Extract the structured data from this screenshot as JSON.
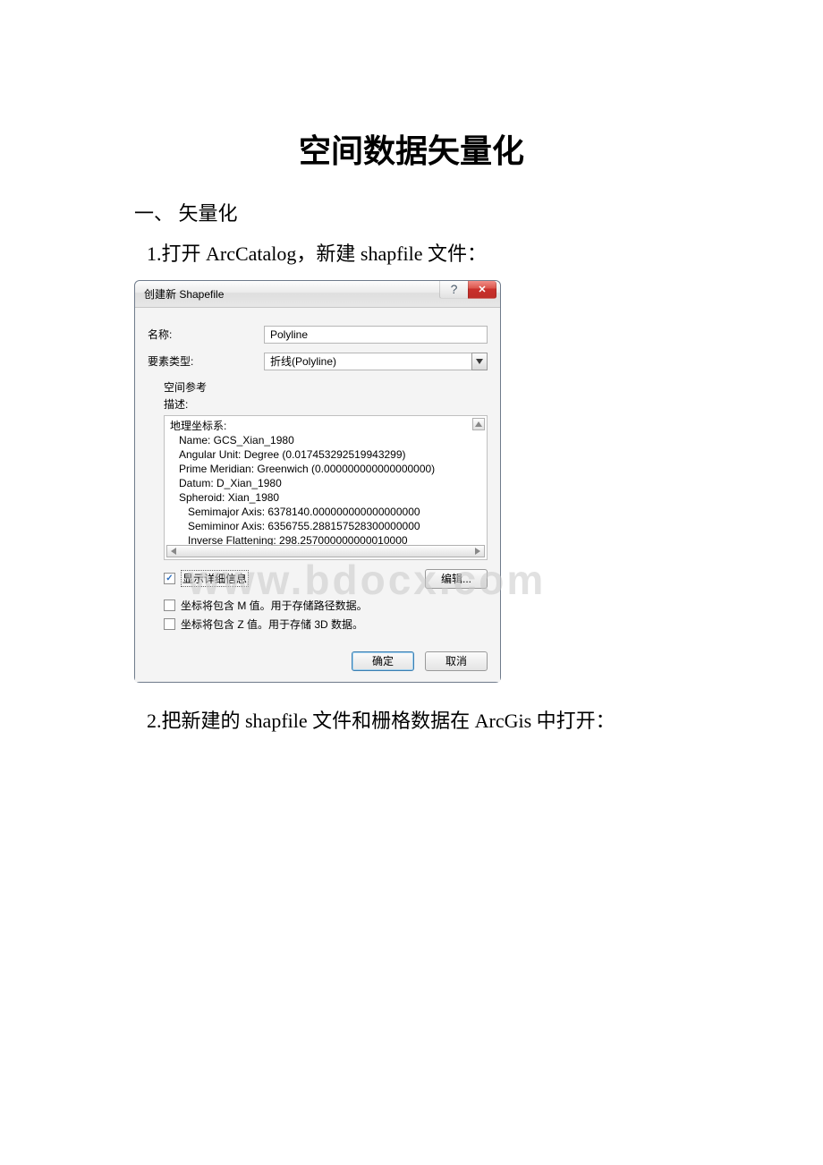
{
  "doc": {
    "title": "空间数据矢量化",
    "section1": "一、 矢量化",
    "step1": "1.打开 ArcCatalog，新建 shapfile 文件：",
    "step2": "2.把新建的 shapfile 文件和栅格数据在 ArcGis 中打开："
  },
  "dialog": {
    "title": "创建新 Shapefile",
    "name_label": "名称:",
    "name_value": "Polyline",
    "type_label": "要素类型:",
    "type_value": "折线(Polyline)",
    "spatial_ref": "空间参考",
    "desc_label": "描述:",
    "cs_heading": "地理坐标系:",
    "cs_name": "Name: GCS_Xian_1980",
    "cs_angular": "Angular Unit: Degree (0.017453292519943299)",
    "cs_prime": "Prime Meridian: Greenwich (0.000000000000000000)",
    "cs_datum": "Datum: D_Xian_1980",
    "cs_spheroid": "Spheroid: Xian_1980",
    "cs_semimajor": "Semimajor Axis: 6378140.000000000000000000",
    "cs_semiminor": "Semiminor Axis: 6356755.288157528300000000",
    "cs_invflat": "Inverse Flattening: 298.257000000000010000",
    "show_detail": "显示详细信息",
    "edit_btn": "编辑...",
    "m_check": "坐标将包含 M 值。用于存储路径数据。",
    "z_check": "坐标将包含 Z 值。用于存储 3D 数据。",
    "ok": "确定",
    "cancel": "取消"
  },
  "watermark": "www.bdocx.com"
}
